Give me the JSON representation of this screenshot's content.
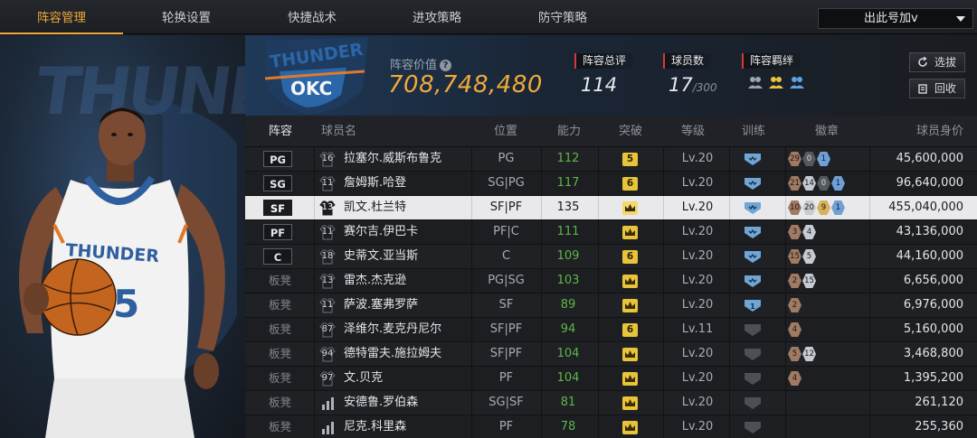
{
  "nav": {
    "tabs": [
      "阵容管理",
      "轮换设置",
      "快捷战术",
      "进攻策略",
      "防守策略"
    ],
    "active_index": 0,
    "dropdown_label": "出此号加v"
  },
  "team": {
    "logo_text": "THUNDER",
    "logo_abbr": "OKC",
    "value_label": "阵容价值",
    "value": "708,748,480",
    "rating_label": "阵容总评",
    "rating": "114",
    "count_label": "球员数",
    "count": "17",
    "count_max": "/300",
    "bond_label": "阵容羁绊",
    "select_button": "选拔",
    "recycle_button": "回收"
  },
  "player_art": {
    "jersey_text": "THUNDER",
    "jersey_number": "5"
  },
  "table": {
    "headers": [
      "阵容",
      "球员名",
      "位置",
      "能力",
      "突破",
      "等级",
      "训练",
      "徽章",
      "球员身价"
    ],
    "rows": [
      {
        "slot": "PG",
        "bench": false,
        "num": "16",
        "name": "拉塞尔.威斯布鲁克",
        "pos": "PG",
        "ability": "112",
        "break": "5",
        "level": "Lv.20",
        "train": "active",
        "badges": [
          [
            "29",
            "bronze"
          ],
          [
            "0",
            "dark"
          ],
          [
            "1",
            "blue"
          ]
        ],
        "salary": "45,600,000",
        "selected": false
      },
      {
        "slot": "SG",
        "bench": false,
        "num": "11",
        "name": "詹姆斯.哈登",
        "pos": "SG|PG",
        "ability": "117",
        "break": "6",
        "level": "Lv.20",
        "train": "active",
        "badges": [
          [
            "21",
            "bronze"
          ],
          [
            "14",
            "silver"
          ],
          [
            "0",
            "dark"
          ],
          [
            "1",
            "blue"
          ]
        ],
        "salary": "96,640,000",
        "selected": false
      },
      {
        "slot": "SF",
        "bench": false,
        "num": "13",
        "name": "凯文.杜兰特",
        "pos": "SF|PF",
        "ability": "135",
        "break": "crown",
        "level": "Lv.20",
        "train": "active",
        "badges": [
          [
            "10",
            "bronze"
          ],
          [
            "20",
            "silver"
          ],
          [
            "9",
            "gold"
          ],
          [
            "1",
            "blue"
          ]
        ],
        "salary": "455,040,000",
        "selected": true
      },
      {
        "slot": "PF",
        "bench": false,
        "num": "11",
        "name": "赛尔吉.伊巴卡",
        "pos": "PF|C",
        "ability": "111",
        "break": "crown",
        "level": "Lv.20",
        "train": "active",
        "badges": [
          [
            "3",
            "bronze"
          ],
          [
            "4",
            "silver"
          ]
        ],
        "salary": "43,136,000",
        "selected": false
      },
      {
        "slot": "C",
        "bench": false,
        "num": "18",
        "name": "史蒂文.亚当斯",
        "pos": "C",
        "ability": "109",
        "break": "6",
        "level": "Lv.20",
        "train": "active",
        "badges": [
          [
            "15",
            "bronze"
          ],
          [
            "5",
            "silver"
          ]
        ],
        "salary": "44,160,000",
        "selected": false
      },
      {
        "slot": "板凳",
        "bench": true,
        "num": "13",
        "name": "雷杰.杰克逊",
        "pos": "PG|SG",
        "ability": "103",
        "break": "crown",
        "level": "Lv.20",
        "train": "active",
        "badges": [
          [
            "2",
            "bronze"
          ],
          [
            "15",
            "silver"
          ]
        ],
        "salary": "6,656,000",
        "selected": false
      },
      {
        "slot": "板凳",
        "bench": true,
        "num": "11",
        "name": "萨波.塞弗罗萨",
        "pos": "SF",
        "ability": "89",
        "break": "crown",
        "level": "Lv.20",
        "train": "one",
        "badges": [
          [
            "2",
            "bronze"
          ]
        ],
        "salary": "6,976,000",
        "selected": false
      },
      {
        "slot": "板凳",
        "bench": true,
        "num": "87",
        "name": "泽维尔.麦克丹尼尔",
        "pos": "SF|PF",
        "ability": "94",
        "break": "6",
        "level": "Lv.11",
        "train": "inactive",
        "badges": [
          [
            "4",
            "bronze"
          ]
        ],
        "salary": "5,160,000",
        "selected": false
      },
      {
        "slot": "板凳",
        "bench": true,
        "num": "94",
        "name": "德特雷夫.施拉姆夫",
        "pos": "SF|PF",
        "ability": "104",
        "break": "crown",
        "level": "Lv.20",
        "train": "inactive",
        "badges": [
          [
            "5",
            "bronze"
          ],
          [
            "12",
            "silver"
          ]
        ],
        "salary": "3,468,800",
        "selected": false
      },
      {
        "slot": "板凳",
        "bench": true,
        "num": "97",
        "name": "文.贝克",
        "pos": "PF",
        "ability": "104",
        "break": "crown",
        "level": "Lv.20",
        "train": "inactive",
        "badges": [
          [
            "4",
            "bronze"
          ]
        ],
        "salary": "1,395,200",
        "selected": false
      },
      {
        "slot": "板凳",
        "bench": true,
        "num": "",
        "name": "安德鲁.罗伯森",
        "pos": "SG|SF",
        "ability": "81",
        "break": "crown",
        "level": "Lv.20",
        "train": "inactive",
        "badges": [],
        "salary": "261,120",
        "selected": false
      },
      {
        "slot": "板凳",
        "bench": true,
        "num": "",
        "name": "尼克.科里森",
        "pos": "PF",
        "ability": "78",
        "break": "crown",
        "level": "Lv.20",
        "train": "inactive",
        "badges": [],
        "salary": "255,360",
        "selected": false
      }
    ]
  },
  "colors": {
    "accent": "#f0a93a",
    "ability_green": "#5fb548",
    "selected_row": "#e9e9eb",
    "stat_marker": "#d23a3a"
  }
}
